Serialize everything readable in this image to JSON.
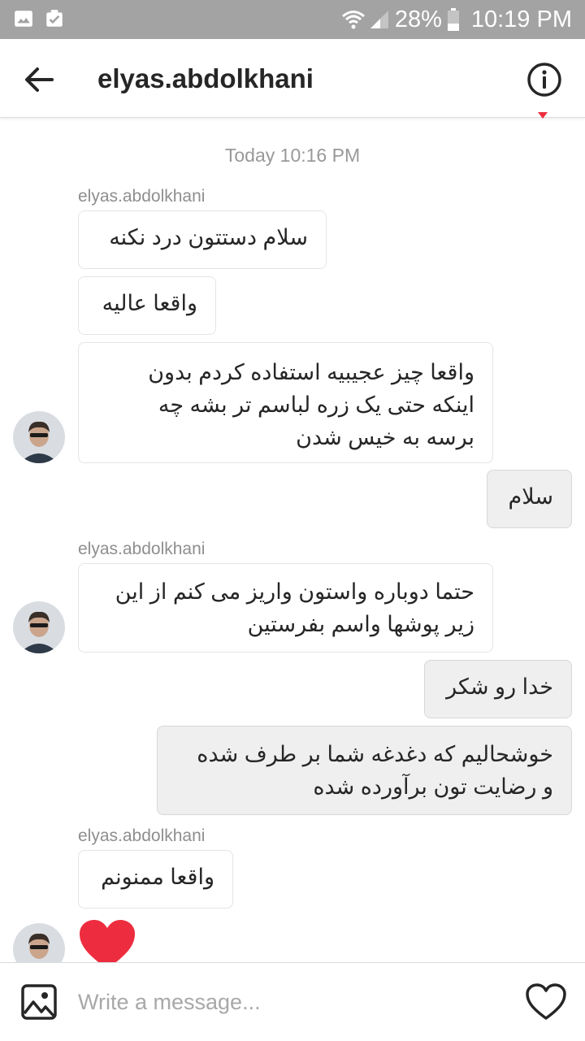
{
  "status_bar": {
    "battery_percent": "28%",
    "time": "10:19 PM"
  },
  "header": {
    "username": "elyas.abdolkhani"
  },
  "thread": {
    "date_separator": "Today 10:16 PM",
    "sender_name": "elyas.abdolkhani",
    "messages": [
      {
        "from": "them",
        "text": "سلام دستتون درد نکنه"
      },
      {
        "from": "them",
        "text": "واقعا عالیه"
      },
      {
        "from": "them",
        "lines": [
          "واقعا چیز عجیبیه استفاده کردم بدون",
          "اینکه حتی یک زره لباسم تر بشه چه",
          "برسه به خیس شدن"
        ]
      },
      {
        "from": "me",
        "text": "سلام"
      },
      {
        "from": "them",
        "lines": [
          "حتما دوباره واستون واریز می کنم از این",
          "زیر پوشها واسم بفرستین"
        ]
      },
      {
        "from": "me",
        "text": "خدا رو شکر"
      },
      {
        "from": "me",
        "lines": [
          "خوشحالیم که دغدغه شما بر طرف شده",
          "و رضایت تون برآورده شده"
        ]
      },
      {
        "from": "them",
        "text": "واقعا ممنونم"
      },
      {
        "from": "them",
        "type": "heart"
      }
    ]
  },
  "composer": {
    "placeholder": "Write a message..."
  },
  "colors": {
    "heart": "#ed2d3f",
    "status_bar": "#a3a3a3",
    "outgoing_bubble": "#efefef"
  },
  "icons": [
    "image-icon",
    "clipboard-check-icon",
    "wifi-icon",
    "signal-icon",
    "battery-icon",
    "back-arrow-icon",
    "info-icon",
    "gallery-icon",
    "heart-icon"
  ]
}
